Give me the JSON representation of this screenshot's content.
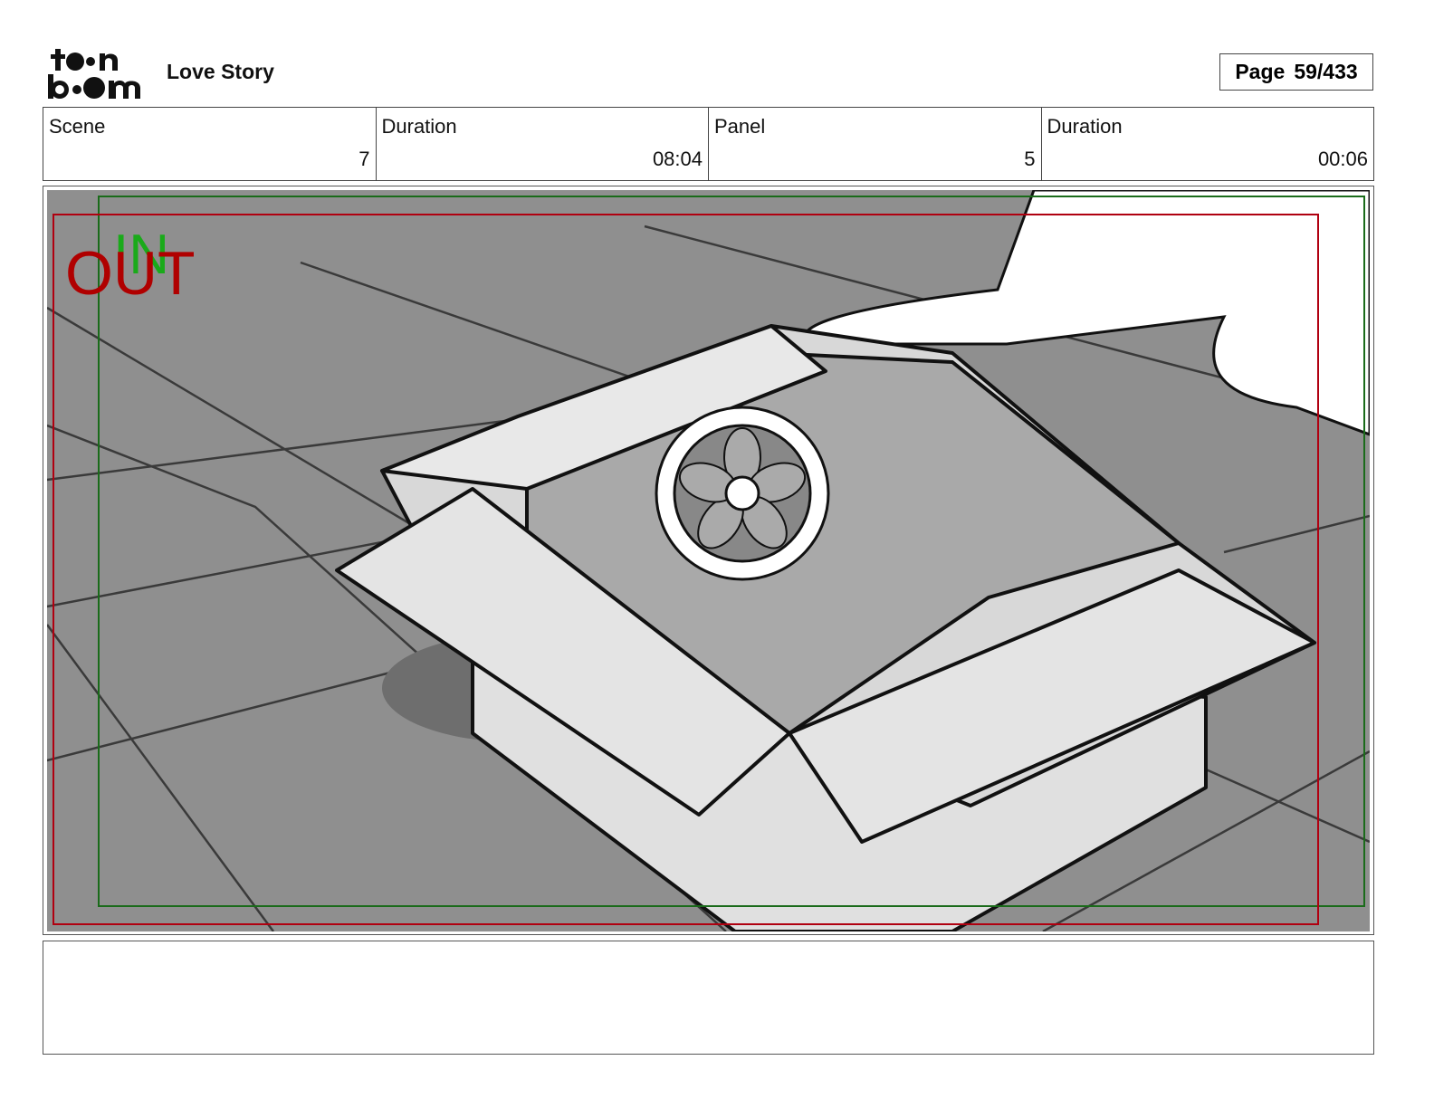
{
  "header": {
    "project_title": "Love Story",
    "logo_text": "toon boom",
    "page_label": "Page",
    "page_value": "59/433"
  },
  "info": [
    {
      "label": "Scene",
      "value": "7"
    },
    {
      "label": "Duration",
      "value": "08:04"
    },
    {
      "label": "Panel",
      "value": "5"
    },
    {
      "label": "Duration",
      "value": "00:06"
    }
  ],
  "panel": {
    "in_marker": "IN",
    "out_marker": "OUT",
    "colors": {
      "in": "#1aaa1a",
      "out": "#b00000",
      "safe_frame": "#1a6b1a",
      "camera_frame": "#b00010",
      "background": "#8f8f8f"
    }
  },
  "notes": {
    "text": ""
  }
}
